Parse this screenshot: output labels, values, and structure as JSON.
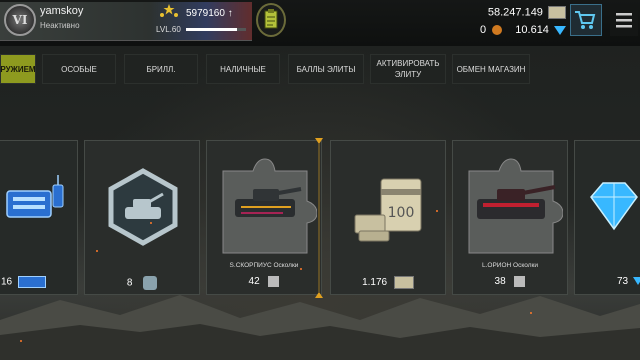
{
  "profile": {
    "emblem": "VI",
    "username": "yamskoy",
    "status": "Неактивно",
    "score": "5979160",
    "level": "LVL.60",
    "xp_progress_fraction": 0.85
  },
  "resources": {
    "gold": "58.247.149",
    "tokens": "0",
    "diamonds": "10.614"
  },
  "tabs": [
    {
      "label": "РУЖИЕМ",
      "active": true
    },
    {
      "label": "ОСОБЫЕ",
      "active": false
    },
    {
      "label": "БРИЛЛ.",
      "active": false
    },
    {
      "label": "НАЛИЧНЫЕ",
      "active": false
    },
    {
      "label": "БАЛЛЫ ЭЛИТЫ",
      "active": false
    },
    {
      "label": "АКТИВИРОВАТЬ ЭЛИТУ",
      "active": false
    },
    {
      "label": "ОБМЕН МАГАЗИН",
      "active": false
    }
  ],
  "cards": [
    {
      "caption": "",
      "count": "16",
      "icon": "radio-equipment-icon"
    },
    {
      "caption": "",
      "count": "8",
      "icon": "tank-badge-icon"
    },
    {
      "caption": "S.СКОРПИУС Осколки",
      "count": "42",
      "icon": "puzzle-piece-icon"
    },
    {
      "caption": "",
      "count": "1.176",
      "icon": "cash-stack-icon"
    },
    {
      "caption": "L.ОРИОН Осколки",
      "count": "38",
      "icon": "puzzle-piece-icon"
    },
    {
      "caption": "",
      "count": "73",
      "icon": "diamond-icon"
    }
  ],
  "colors": {
    "active_tab": "#8e9a1f",
    "diamond": "#38b8ff",
    "cash": "#d8d0b0",
    "accent_gold": "#e0a020"
  }
}
